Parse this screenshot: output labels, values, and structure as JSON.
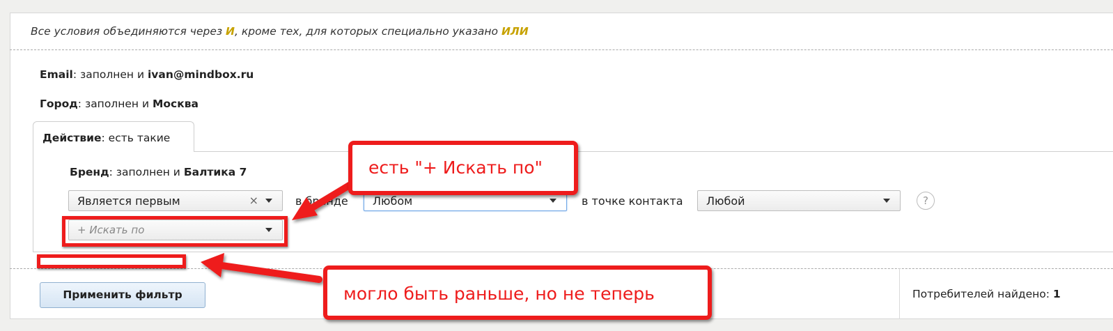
{
  "notice": {
    "before": "Все условия объединяются через ",
    "and_keyword": "И",
    "middle": ", кроме тех, для которых специально указано ",
    "or_keyword": "ИЛИ"
  },
  "conditions": {
    "email": {
      "field": "Email",
      "op": ": заполнен и ",
      "value": "ivan@mindbox.ru"
    },
    "city": {
      "field": "Город",
      "op": ": заполнен и ",
      "value": "Москва"
    }
  },
  "action_tab": {
    "field": "Действие",
    "rest": ": есть такие"
  },
  "brand_condition": {
    "field": "Бренд",
    "op": ": заполнен и ",
    "value": "Балтика 7"
  },
  "filters": {
    "first_select": {
      "value": "Является первым",
      "clear": "×"
    },
    "brand_label": "в бренде",
    "brand_select": {
      "value": "Любом"
    },
    "contact_label": "в точке контакта",
    "contact_select": {
      "value": "Любой"
    },
    "help": "?",
    "search_by": {
      "placeholder": "+ Искать по"
    }
  },
  "footer": {
    "apply_button": "Применить фильтр",
    "found_label": "Потребителей найдено: ",
    "found_count": "1"
  },
  "annotations": {
    "callout_top": "есть \"+ Искать по\"",
    "callout_bottom": "могло быть раньше, но не теперь"
  },
  "colors": {
    "annotation_red": "#ee1c1c",
    "keyword_gold": "#c7a200",
    "focus_blue": "#6fa6e6"
  }
}
